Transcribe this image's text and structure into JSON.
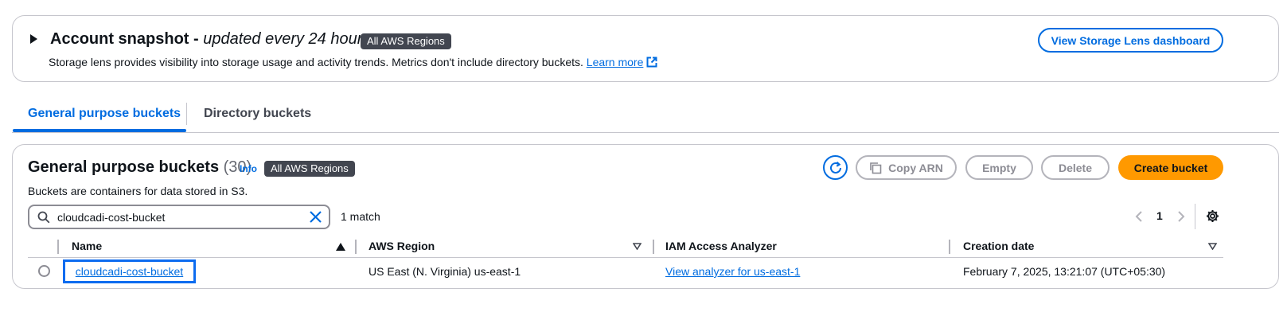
{
  "snapshot": {
    "title": "Account snapshot - ",
    "title_italic": "updated every 24 hours",
    "badge": "All AWS Regions",
    "description": "Storage lens provides visibility into storage usage and activity trends. Metrics don't include directory buckets.",
    "learn_more": "Learn more",
    "dashboard_button": "View Storage Lens dashboard"
  },
  "tabs": [
    {
      "label": "General purpose buckets",
      "active": true
    },
    {
      "label": "Directory buckets",
      "active": false
    }
  ],
  "buckets": {
    "title": "General purpose buckets",
    "count": "(30)",
    "info": "Info",
    "badge": "All AWS Regions",
    "description": "Buckets are containers for data stored in S3.",
    "actions": {
      "copy_arn": "Copy ARN",
      "empty": "Empty",
      "delete": "Delete",
      "create": "Create bucket"
    },
    "search": {
      "value": "cloudcadi-cost-bucket",
      "placeholder": "Find buckets by name"
    },
    "match_text": "1 match",
    "page": "1",
    "columns": [
      "Name",
      "AWS Region",
      "IAM Access Analyzer",
      "Creation date"
    ],
    "rows": [
      {
        "name": "cloudcadi-cost-bucket",
        "region": "US East (N. Virginia) us-east-1",
        "analyzer": "View analyzer for us-east-1",
        "created": "February 7, 2025, 13:21:07 (UTC+05:30)"
      }
    ]
  },
  "colors": {
    "accent": "#006ce0",
    "primary_button": "#ff9900",
    "badge": "#424650"
  },
  "icons": [
    "caret-right-icon",
    "external-link-icon",
    "refresh-icon",
    "copy-icon",
    "search-icon",
    "clear-icon",
    "chevron-left-icon",
    "chevron-right-icon",
    "settings-icon",
    "sort-ascending-icon",
    "sort-descending-icon"
  ]
}
